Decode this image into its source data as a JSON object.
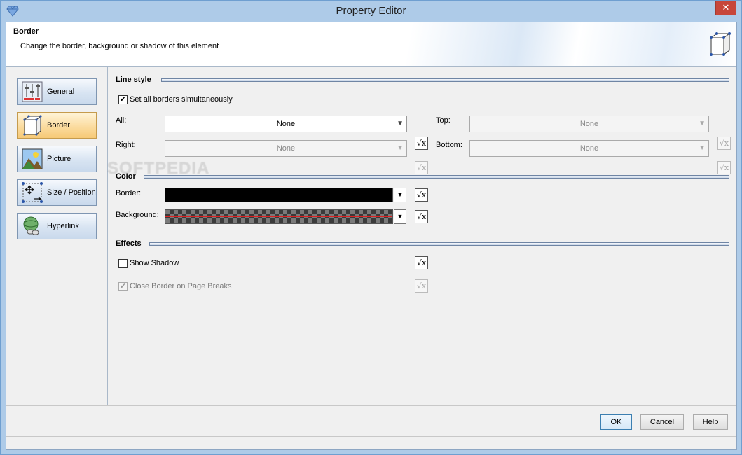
{
  "window": {
    "title": "Property Editor"
  },
  "header": {
    "title": "Border",
    "description": "Change the border, background or shadow of this element"
  },
  "nav": {
    "items": [
      {
        "label": "General",
        "icon": "sliders-icon"
      },
      {
        "label": "Border",
        "icon": "border-box-icon"
      },
      {
        "label": "Picture",
        "icon": "picture-icon"
      },
      {
        "label": "Size / Position",
        "icon": "move-resize-icon"
      },
      {
        "label": "Hyperlink",
        "icon": "globe-link-icon"
      }
    ],
    "active": "Border"
  },
  "line_style": {
    "title": "Line style",
    "set_all_label": "Set all borders simultaneously",
    "set_all_checked": true,
    "all_label": "All:",
    "all_value": "None",
    "top_label": "Top:",
    "top_value": "None",
    "right_label": "Right:",
    "right_value": "None",
    "bottom_label": "Bottom:",
    "bottom_value": "None"
  },
  "color": {
    "title": "Color",
    "border_label": "Border:",
    "background_label": "Background:"
  },
  "effects": {
    "title": "Effects",
    "show_shadow_label": "Show Shadow",
    "show_shadow_checked": false,
    "close_border_label": "Close Border on Page Breaks",
    "close_border_checked": true
  },
  "footer": {
    "ok": "OK",
    "cancel": "Cancel",
    "help": "Help"
  },
  "glyphs": {
    "close": "✕",
    "check": "✔",
    "arrow": "▼",
    "fx": "√x"
  },
  "watermark": "SOFTPEDIA"
}
